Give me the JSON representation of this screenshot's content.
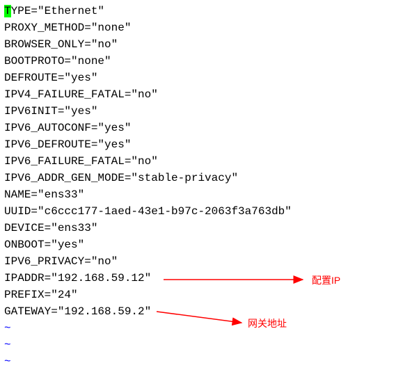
{
  "config": {
    "lines": [
      {
        "key": "TYPE",
        "value": "\"Ethernet\"",
        "cursor_first": true
      },
      {
        "key": "PROXY_METHOD",
        "value": "\"none\""
      },
      {
        "key": "BROWSER_ONLY",
        "value": "\"no\""
      },
      {
        "key": "BOOTPROTO",
        "value": "\"none\""
      },
      {
        "key": "DEFROUTE",
        "value": "\"yes\""
      },
      {
        "key": "IPV4_FAILURE_FATAL",
        "value": "\"no\""
      },
      {
        "key": "IPV6INIT",
        "value": "\"yes\""
      },
      {
        "key": "IPV6_AUTOCONF",
        "value": "\"yes\""
      },
      {
        "key": "IPV6_DEFROUTE",
        "value": "\"yes\""
      },
      {
        "key": "IPV6_FAILURE_FATAL",
        "value": "\"no\""
      },
      {
        "key": "IPV6_ADDR_GEN_MODE",
        "value": "\"stable-privacy\""
      },
      {
        "key": "NAME",
        "value": "\"ens33\""
      },
      {
        "key": "UUID",
        "value": "\"c6ccc177-1aed-43e1-b97c-2063f3a763db\""
      },
      {
        "key": "DEVICE",
        "value": "\"ens33\""
      },
      {
        "key": "ONBOOT",
        "value": "\"yes\""
      },
      {
        "key": "IPV6_PRIVACY",
        "value": "\"no\""
      },
      {
        "key": "IPADDR",
        "value": "\"192.168.59.12\""
      },
      {
        "key": "PREFIX",
        "value": "\"24\""
      },
      {
        "key": "GATEWAY",
        "value": "\"192.168.59.2\""
      }
    ],
    "tilde": "~"
  },
  "annotations": {
    "ipaddr_label": "配置IP",
    "gateway_label": "网关地址"
  }
}
